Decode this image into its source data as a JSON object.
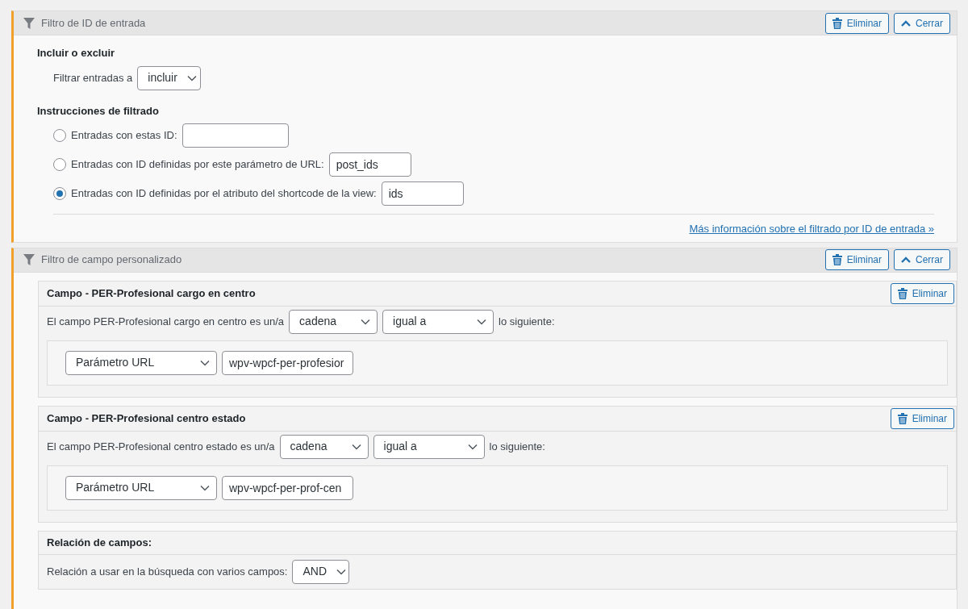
{
  "panels": [
    {
      "kind": "id_filter",
      "title": "Filtro de ID de entrada",
      "buttons": [
        {
          "kind": "delete",
          "label": "Eliminar"
        },
        {
          "kind": "collapse",
          "label": "Cerrar"
        }
      ],
      "include_section": {
        "heading": "Incluir o excluir",
        "label": "Filtrar entradas a",
        "select": "incluir"
      },
      "instructions": {
        "heading": "Instrucciones de filtrado",
        "options": [
          {
            "label": "Entradas con estas ID:",
            "selected": false
          },
          {
            "label": "Entradas con ID definidas por este parámetro de URL:",
            "value": "post_ids",
            "selected": false
          },
          {
            "label": "Entradas con ID definidas por el atributo del shortcode de la view:",
            "value": "ids",
            "selected": true
          }
        ]
      },
      "link": "Más información sobre el filtrado por ID de entrada »"
    },
    {
      "kind": "custom_field_filter",
      "title": "Filtro de campo personalizado",
      "buttons": [
        {
          "kind": "delete",
          "label": "Eliminar"
        },
        {
          "kind": "collapse",
          "label": "Cerrar"
        }
      ],
      "fields": [
        {
          "title": "Campo - PER-Profesional cargo en centro",
          "delete": "Eliminar",
          "sentence": "El campo PER-Profesional cargo en centro es un/a",
          "type": "cadena",
          "compare": "igual a",
          "suffix": "lo siguiente:",
          "source": "Parámetro URL",
          "value": "wpv-wpcf-per-profesior"
        },
        {
          "title": "Campo - PER-Profesional centro estado",
          "delete": "Eliminar",
          "sentence": "El campo PER-Profesional centro estado es un/a",
          "type": "cadena",
          "compare": "igual a",
          "suffix": "lo siguiente:",
          "source": "Parámetro URL",
          "value": "wpv-wpcf-per-prof-cen"
        }
      ],
      "relation": {
        "title": "Relación de campos:",
        "label": "Relación a usar en la búsqueda con varios campos:",
        "select": "AND"
      }
    }
  ]
}
